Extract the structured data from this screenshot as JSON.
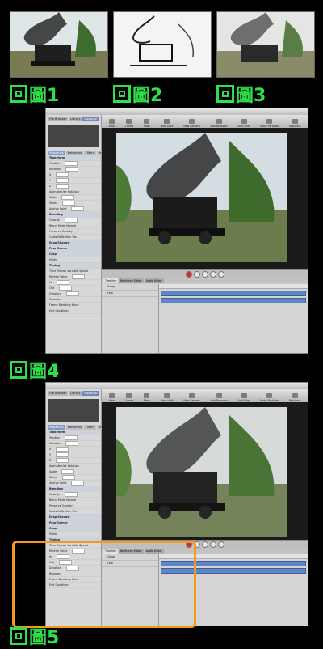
{
  "figures": {
    "fig1": "圖1",
    "fig2": "圖2",
    "fig3": "圖3",
    "fig4": "圖4",
    "fig5": "圖5"
  },
  "app": {
    "left_tabs": [
      "File Browser",
      "Library",
      "Inspector"
    ],
    "prop_tabs": [
      "Properties",
      "Behaviors",
      "Filters",
      "Image"
    ],
    "properties": [
      {
        "label": "Transform",
        "section": true
      },
      {
        "label": "Position",
        "section": false
      },
      {
        "label": "Rotation",
        "section": false
      },
      {
        "label": "X",
        "section": false
      },
      {
        "label": "Y",
        "section": false
      },
      {
        "label": "Z",
        "section": false
      },
      {
        "label": "Animate",
        "section": false
      },
      {
        "label": "Scale",
        "section": false
      },
      {
        "label": "Shear",
        "section": false
      },
      {
        "label": "Anchor Point",
        "section": false
      },
      {
        "label": "Blending",
        "section": true
      },
      {
        "label": "Opacity",
        "section": false
      },
      {
        "label": "Blend Mode",
        "section": false
      },
      {
        "label": "Preserve Opacity",
        "section": false
      },
      {
        "label": "Casts Reflection",
        "section": false
      },
      {
        "label": "Drop Shadow",
        "section": true
      },
      {
        "label": "Four Corner",
        "section": true
      },
      {
        "label": "Crop",
        "section": true
      },
      {
        "label": "Media",
        "section": false
      },
      {
        "label": "Timing",
        "section": true
      },
      {
        "label": "Time Remap",
        "section": false
      },
      {
        "label": "Retime Value",
        "section": false
      },
      {
        "label": "In",
        "section": false
      },
      {
        "label": "Out",
        "section": false
      },
      {
        "label": "Duration",
        "section": false
      },
      {
        "label": "Reverse",
        "section": false
      },
      {
        "label": "Frame Blending",
        "section": false
      },
      {
        "label": "End Condition",
        "section": false
      }
    ],
    "toolbar": [
      "View",
      "Create",
      "Mask",
      "New Light",
      "New Camera",
      "Add Behavior",
      "Add Filter",
      "Make Particles",
      "Replicate"
    ],
    "timeline_tabs": [
      "Timeline",
      "Keyframe Editor",
      "Audio Editor"
    ],
    "layers": [
      "Group",
      "train"
    ],
    "values": {
      "time_remap": "Variable Speed",
      "blend_mode": "Normal",
      "casts_reflection": "Yes",
      "animate": "Use Rotation",
      "frame_blending": "None"
    }
  },
  "colors": {
    "label_green": "#2fe04a",
    "highlight_orange": "#f29a21",
    "timeline_bar": "#5f86c4"
  }
}
